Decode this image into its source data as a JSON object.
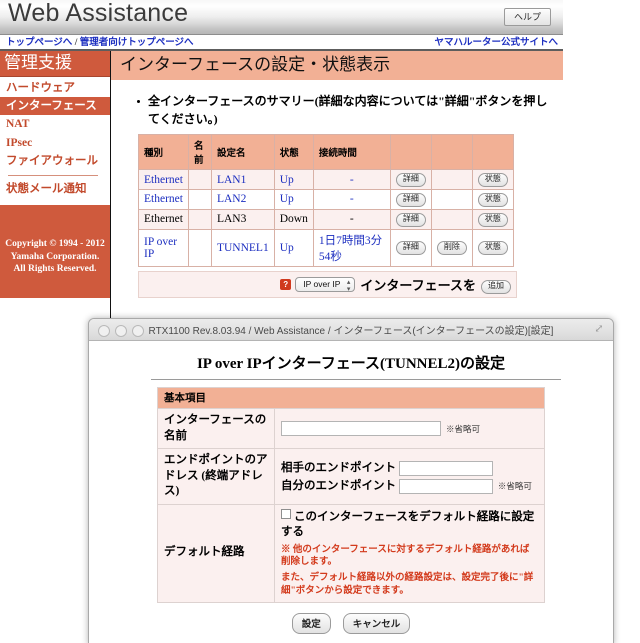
{
  "browser_page": {
    "header": {
      "title": "Web Assistance",
      "help_label": "ヘルプ",
      "nav_left_1": "トップページへ",
      "nav_sep": " / ",
      "nav_left_2": "管理者向けトップページへ",
      "nav_right": "ヤマハルーター公式サイトへ"
    },
    "sidebar": {
      "heading": "管理支援",
      "items": [
        {
          "label": "ハードウェア",
          "active": false
        },
        {
          "label": "インターフェース",
          "active": true
        },
        {
          "label": "NAT",
          "active": false
        },
        {
          "label": "IPsec",
          "active": false
        },
        {
          "label": "ファイアウォール",
          "active": false
        },
        {
          "label": "状態メール通知",
          "active": false
        }
      ],
      "copyright_line1": "Copyright © 1994 - 2012",
      "copyright_line2": "Yamaha Corporation.",
      "copyright_line3": "All Rights Reserved."
    },
    "content": {
      "page_banner": "インターフェースの設定・状態表示",
      "bullet_text": "全インターフェースのサマリー(詳細な内容については\"詳細\"ボタンを押してください。)",
      "table": {
        "headers": [
          "種別",
          "名前",
          "設定名",
          "状態",
          "接続時間",
          "",
          "",
          ""
        ],
        "rows": [
          {
            "type": "Ethernet",
            "name": "",
            "config": "LAN1",
            "state": "Up",
            "uptime": "-",
            "detail": "詳細",
            "delete": "",
            "status": "状態",
            "down": false
          },
          {
            "type": "Ethernet",
            "name": "",
            "config": "LAN2",
            "state": "Up",
            "uptime": "-",
            "detail": "詳細",
            "delete": "",
            "status": "状態",
            "down": false
          },
          {
            "type": "Ethernet",
            "name": "",
            "config": "LAN3",
            "state": "Down",
            "uptime": "-",
            "detail": "詳細",
            "delete": "",
            "status": "状態",
            "down": true
          },
          {
            "type": "IP over IP",
            "name": "",
            "config": "TUNNEL1",
            "state": "Up",
            "uptime": "1日7時間3分54秒",
            "detail": "詳細",
            "delete": "削除",
            "status": "状態",
            "down": false
          }
        ]
      },
      "add_row": {
        "help_mark": "?",
        "select_value": "IP over IP",
        "label": "インターフェースを",
        "add_button": "追加"
      }
    }
  },
  "dialog": {
    "titlebar": "RTX1100 Rev.8.03.94 / Web Assistance / インターフェース(インターフェースの設定)[設定]",
    "resize_icon": "⤢",
    "heading": "IP over IPインターフェース(TUNNEL2)の設定",
    "section_header": "基本項目",
    "fields": {
      "name_label": "インターフェースの名前",
      "name_value": "",
      "name_note": "※省略可",
      "endpoint_label": "エンドポイントのアドレス (終端アドレス)",
      "peer_endpoint_label": "相手のエンドポイント",
      "peer_endpoint_value": "",
      "local_endpoint_label": "自分のエンドポイント",
      "local_endpoint_value": "",
      "local_endpoint_note": "※省略可",
      "default_route_label": "デフォルト経路",
      "default_route_checkbox_label": "このインターフェースをデフォルト経路に設定する",
      "default_route_checked": false,
      "warning_line1": "※ 他のインターフェースに対するデフォルト経路があれば削除します。",
      "warning_line2": "また、デフォルト経路以外の経路設定は、設定完了後に\"詳細\"ボタンから設定できます。"
    },
    "actions": {
      "submit": "設定",
      "cancel": "キャンセル"
    }
  },
  "colors": {
    "banner": "#f2b095",
    "sidebar_accent": "#cf5a3d",
    "link": "#1d2fc0",
    "warning": "#d33a1c",
    "row_alt": "#fbf0ef"
  }
}
